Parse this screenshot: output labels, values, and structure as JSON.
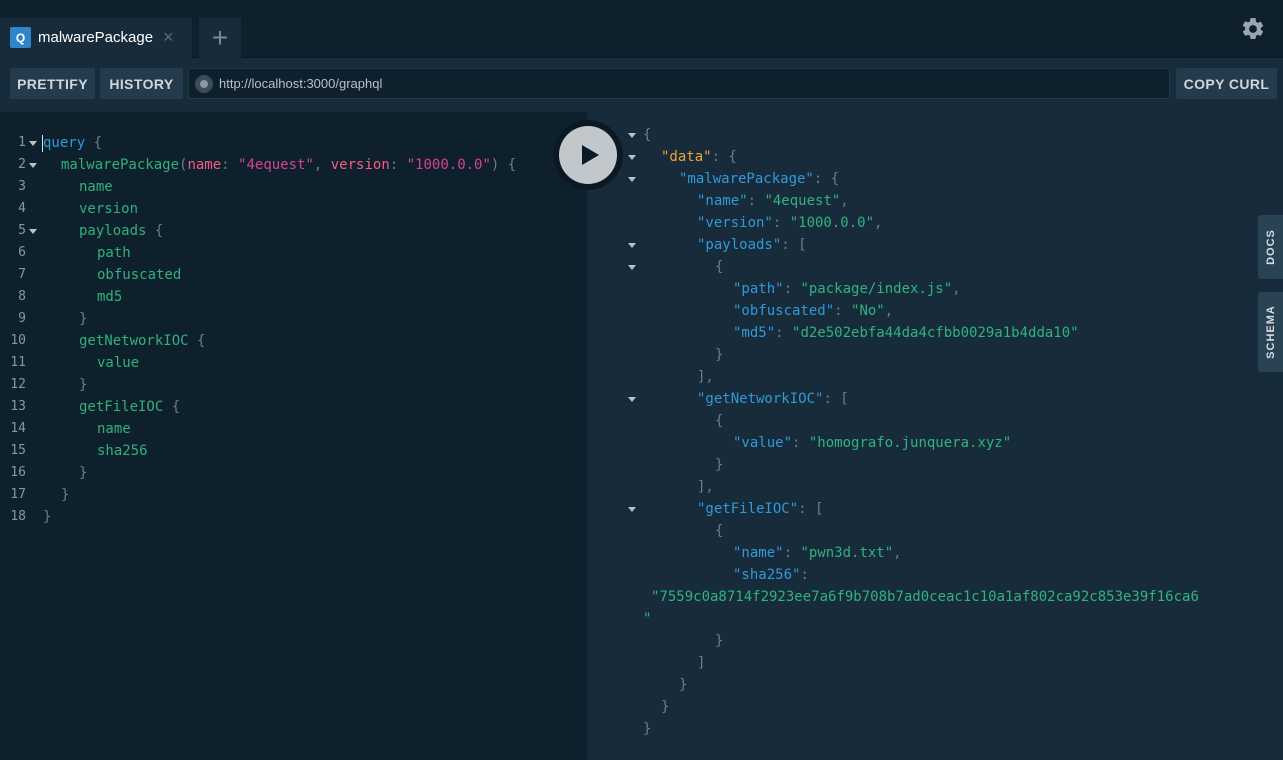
{
  "tab": {
    "badge": "Q",
    "title": "malwarePackage",
    "close": "×"
  },
  "new_tab": "+",
  "toolbar": {
    "prettify": "PRETTIFY",
    "history": "HISTORY",
    "url": "http://localhost:3000/graphql",
    "copy_curl": "COPY CURL"
  },
  "side_tabs": {
    "docs": "DOCS",
    "schema": "SCHEMA"
  },
  "query_lines": [
    {
      "n": "1",
      "fold": true,
      "indent": 0,
      "t": [
        [
          "kw",
          "query"
        ],
        [
          "pun",
          " {"
        ]
      ]
    },
    {
      "n": "2",
      "fold": true,
      "indent": 1,
      "t": [
        [
          "fld",
          "malwarePackage"
        ],
        [
          "pun",
          "("
        ],
        [
          "arg",
          "name"
        ],
        [
          "pun",
          ": "
        ],
        [
          "str",
          "\"4equest\""
        ],
        [
          "pun",
          ", "
        ],
        [
          "arg",
          "version"
        ],
        [
          "pun",
          ": "
        ],
        [
          "str",
          "\"1000.0.0\""
        ],
        [
          "pun",
          ") {"
        ]
      ]
    },
    {
      "n": "3",
      "fold": false,
      "indent": 2,
      "t": [
        [
          "fld",
          "name"
        ]
      ]
    },
    {
      "n": "4",
      "fold": false,
      "indent": 2,
      "t": [
        [
          "fld",
          "version"
        ]
      ]
    },
    {
      "n": "5",
      "fold": true,
      "indent": 2,
      "t": [
        [
          "fld",
          "payloads"
        ],
        [
          "pun",
          " {"
        ]
      ]
    },
    {
      "n": "6",
      "fold": false,
      "indent": 3,
      "t": [
        [
          "fld",
          "path"
        ]
      ]
    },
    {
      "n": "7",
      "fold": false,
      "indent": 3,
      "t": [
        [
          "fld",
          "obfuscated"
        ]
      ]
    },
    {
      "n": "8",
      "fold": false,
      "indent": 3,
      "t": [
        [
          "fld",
          "md5"
        ]
      ]
    },
    {
      "n": "9",
      "fold": false,
      "indent": 2,
      "t": [
        [
          "pun",
          "}"
        ]
      ]
    },
    {
      "n": "10",
      "fold": false,
      "indent": 2,
      "t": [
        [
          "fld",
          "getNetworkIOC"
        ],
        [
          "pun",
          " {"
        ]
      ]
    },
    {
      "n": "11",
      "fold": false,
      "indent": 3,
      "t": [
        [
          "fld",
          "value"
        ]
      ]
    },
    {
      "n": "12",
      "fold": false,
      "indent": 2,
      "t": [
        [
          "pun",
          "}"
        ]
      ]
    },
    {
      "n": "13",
      "fold": false,
      "indent": 2,
      "t": [
        [
          "fld",
          "getFileIOC"
        ],
        [
          "pun",
          " {"
        ]
      ]
    },
    {
      "n": "14",
      "fold": false,
      "indent": 3,
      "t": [
        [
          "fld",
          "name"
        ]
      ]
    },
    {
      "n": "15",
      "fold": false,
      "indent": 3,
      "t": [
        [
          "fld",
          "sha256"
        ]
      ]
    },
    {
      "n": "16",
      "fold": false,
      "indent": 2,
      "t": [
        [
          "pun",
          "}"
        ]
      ]
    },
    {
      "n": "17",
      "fold": false,
      "indent": 1,
      "t": [
        [
          "pun",
          "}"
        ]
      ]
    },
    {
      "n": "18",
      "fold": false,
      "indent": 0,
      "t": [
        [
          "pun",
          "}"
        ]
      ]
    }
  ],
  "result_lines": [
    {
      "fold": true,
      "indent": 0,
      "t": [
        [
          "pun",
          "{"
        ]
      ]
    },
    {
      "fold": true,
      "indent": 1,
      "t": [
        [
          "dk",
          "\"data\""
        ],
        [
          "pun",
          ": {"
        ]
      ]
    },
    {
      "fold": true,
      "indent": 2,
      "t": [
        [
          "key",
          "\"malwarePackage\""
        ],
        [
          "pun",
          ": {"
        ]
      ]
    },
    {
      "fold": false,
      "indent": 3,
      "t": [
        [
          "key",
          "\"name\""
        ],
        [
          "pun",
          ": "
        ],
        [
          "val",
          "\"4equest\""
        ],
        [
          "pun",
          ","
        ]
      ]
    },
    {
      "fold": false,
      "indent": 3,
      "t": [
        [
          "key",
          "\"version\""
        ],
        [
          "pun",
          ": "
        ],
        [
          "val",
          "\"1000.0.0\""
        ],
        [
          "pun",
          ","
        ]
      ]
    },
    {
      "fold": true,
      "indent": 3,
      "t": [
        [
          "key",
          "\"payloads\""
        ],
        [
          "pun",
          ": ["
        ]
      ]
    },
    {
      "fold": true,
      "indent": 4,
      "t": [
        [
          "pun",
          "{"
        ]
      ]
    },
    {
      "fold": false,
      "indent": 5,
      "t": [
        [
          "key",
          "\"path\""
        ],
        [
          "pun",
          ": "
        ],
        [
          "val",
          "\"package/index.js\""
        ],
        [
          "pun",
          ","
        ]
      ]
    },
    {
      "fold": false,
      "indent": 5,
      "t": [
        [
          "key",
          "\"obfuscated\""
        ],
        [
          "pun",
          ": "
        ],
        [
          "val",
          "\"No\""
        ],
        [
          "pun",
          ","
        ]
      ]
    },
    {
      "fold": false,
      "indent": 5,
      "t": [
        [
          "key",
          "\"md5\""
        ],
        [
          "pun",
          ": "
        ],
        [
          "val",
          "\"d2e502ebfa44da4cfbb0029a1b4dda10\""
        ]
      ]
    },
    {
      "fold": false,
      "indent": 4,
      "t": [
        [
          "pun",
          "}"
        ]
      ]
    },
    {
      "fold": false,
      "indent": 3,
      "t": [
        [
          "pun",
          "],"
        ]
      ]
    },
    {
      "fold": true,
      "indent": 3,
      "t": [
        [
          "key",
          "\"getNetworkIOC\""
        ],
        [
          "pun",
          ": ["
        ]
      ]
    },
    {
      "fold": false,
      "indent": 4,
      "t": [
        [
          "pun",
          "{"
        ]
      ]
    },
    {
      "fold": false,
      "indent": 5,
      "t": [
        [
          "key",
          "\"value\""
        ],
        [
          "pun",
          ": "
        ],
        [
          "val",
          "\"homografo.junquera.xyz\""
        ]
      ]
    },
    {
      "fold": false,
      "indent": 4,
      "t": [
        [
          "pun",
          "}"
        ]
      ]
    },
    {
      "fold": false,
      "indent": 3,
      "t": [
        [
          "pun",
          "],"
        ]
      ]
    },
    {
      "fold": true,
      "indent": 3,
      "t": [
        [
          "key",
          "\"getFileIOC\""
        ],
        [
          "pun",
          ": ["
        ]
      ]
    },
    {
      "fold": false,
      "indent": 4,
      "t": [
        [
          "pun",
          "{"
        ]
      ]
    },
    {
      "fold": false,
      "indent": 5,
      "t": [
        [
          "key",
          "\"name\""
        ],
        [
          "pun",
          ": "
        ],
        [
          "val",
          "\"pwn3d.txt\""
        ],
        [
          "pun",
          ","
        ]
      ]
    },
    {
      "fold": false,
      "indent": 5,
      "t": [
        [
          "key",
          "\"sha256\""
        ],
        [
          "pun",
          ":"
        ]
      ]
    },
    {
      "fold": false,
      "indent": -1,
      "t": [
        [
          "val",
          "\"7559c0a8714f2923ee7a6f9b708b7ad0ceac1c10a1af802ca92c853e39f16ca6"
        ]
      ]
    },
    {
      "fold": false,
      "indent": -2,
      "t": [
        [
          "val",
          "\""
        ]
      ]
    },
    {
      "fold": false,
      "indent": 4,
      "t": [
        [
          "pun",
          "}"
        ]
      ]
    },
    {
      "fold": false,
      "indent": 3,
      "t": [
        [
          "pun",
          "]"
        ]
      ]
    },
    {
      "fold": false,
      "indent": 2,
      "t": [
        [
          "pun",
          "}"
        ]
      ]
    },
    {
      "fold": false,
      "indent": 1,
      "t": [
        [
          "pun",
          "}"
        ]
      ]
    },
    {
      "fold": false,
      "indent": 0,
      "t": [
        [
          "pun",
          "}"
        ]
      ]
    }
  ],
  "icons": {
    "settings": "gear-icon",
    "play": "play-icon"
  }
}
